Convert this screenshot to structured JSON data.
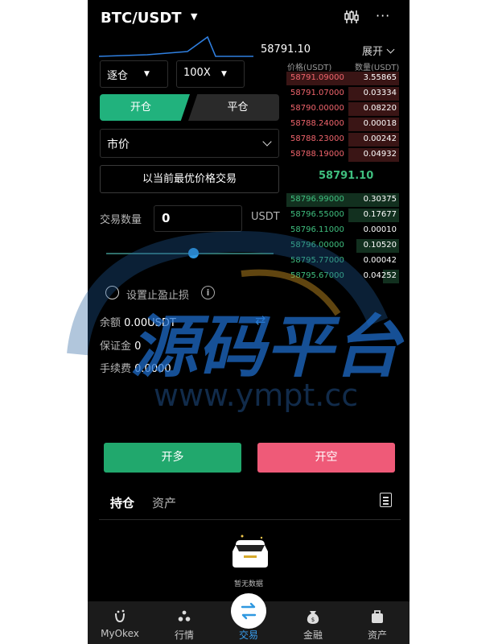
{
  "header": {
    "pair": "BTC/USDT",
    "pair_caret": "▼",
    "more": "···"
  },
  "ticker": {
    "last_price": "58791.10",
    "expand_label": "展开"
  },
  "form": {
    "margin_mode": "逐仓",
    "leverage": "100X",
    "tab_open": "开仓",
    "tab_close": "平仓",
    "order_type": "市价",
    "best_price_button": "以当前最优价格交易",
    "qty_label": "交易数量",
    "qty_value": "0",
    "qty_unit": "USDT",
    "slider_fraction": 0.52,
    "tpsl_label": "设置止盈止损",
    "info_glyph": "i",
    "balance_label": "余额",
    "balance_value": "0.00USDT",
    "margin_label": "保证金",
    "margin_value": "0",
    "fee_label": "手续费",
    "fee_value": "0.0000"
  },
  "orderbook": {
    "price_header": "价格(USDT)",
    "qty_header": "数量(USDT)",
    "mid_price": "58791.10",
    "asks": [
      {
        "price": "58791.09000",
        "qty": "3.55865",
        "depth": 1.0
      },
      {
        "price": "58791.07000",
        "qty": "0.03334",
        "depth": 0.45
      },
      {
        "price": "58790.00000",
        "qty": "0.08220",
        "depth": 0.45
      },
      {
        "price": "58788.24000",
        "qty": "0.00018",
        "depth": 0.45
      },
      {
        "price": "58788.23000",
        "qty": "0.00242",
        "depth": 0.45
      },
      {
        "price": "58788.19000",
        "qty": "0.04932",
        "depth": 0.45
      }
    ],
    "bids": [
      {
        "price": "58796.99000",
        "qty": "0.30375",
        "depth": 1.0
      },
      {
        "price": "58796.55000",
        "qty": "0.17677",
        "depth": 0.45
      },
      {
        "price": "58796.11000",
        "qty": "0.00010",
        "depth": 0.0
      },
      {
        "price": "58796.00000",
        "qty": "0.10520",
        "depth": 0.38
      },
      {
        "price": "58795.77000",
        "qty": "0.00042",
        "depth": 0.0
      },
      {
        "price": "58795.67000",
        "qty": "0.04252",
        "depth": 0.14
      }
    ]
  },
  "actions": {
    "long": "开多",
    "short": "开空"
  },
  "positions": {
    "tab_holdings": "持仓",
    "tab_assets": "资产",
    "empty_text": "暂无数据"
  },
  "nav": [
    {
      "label": "MyOkex",
      "icon": "myokex-icon"
    },
    {
      "label": "行情",
      "icon": "market-icon"
    },
    {
      "label": "交易",
      "icon": "trade-icon"
    },
    {
      "label": "金融",
      "icon": "finance-icon"
    },
    {
      "label": "资产",
      "icon": "assets-icon"
    }
  ],
  "watermark": {
    "title": "源码平台",
    "url": "www.ympt.cc"
  },
  "colors": {
    "up": "#3fbf7f",
    "down": "#f0646c",
    "accent": "#21b27d",
    "short": "#ef5a78",
    "link": "#3a9ff0"
  }
}
